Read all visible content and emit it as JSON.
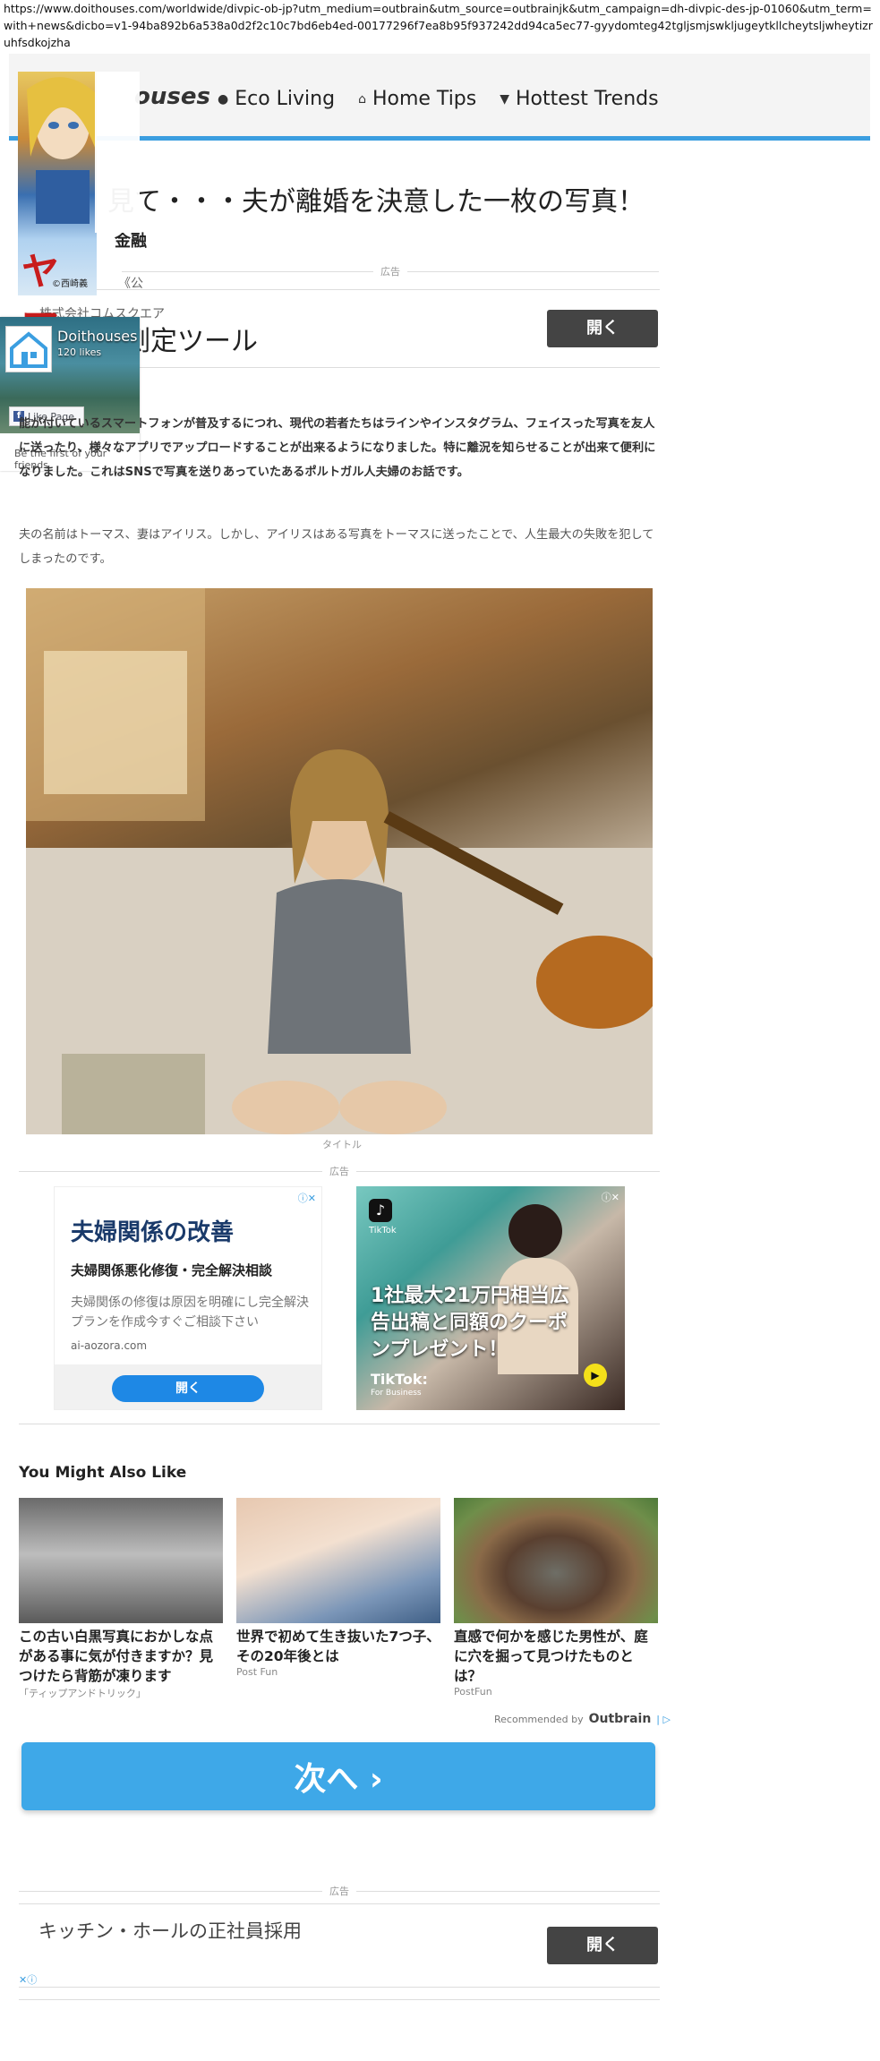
{
  "browser": {
    "url": "https://www.doithouses.com/worldwide/divpic-ob-jp?utm_medium=outbrain&utm_source=outbrainjk&utm_campaign=dh-divpic-des-jp-01060&utm_term=with+news&dicbo=v1-94ba892b6a538a0d2f2c10c7bd6eb4ed-00177296f7ea8b95f937242dd94ca5ec77-gyydomteg42tgljsmjswkljugeytkllcheytsljwheytizruhfsdkojzha"
  },
  "header": {
    "logo_text": "ouses",
    "nav": [
      {
        "label": "Eco Living",
        "icon": "globe-icon"
      },
      {
        "label": "Home Tips",
        "icon": "home-icon"
      },
      {
        "label": "Hottest Trends",
        "icon": "trophy-icon"
      }
    ],
    "accent_color": "#3b9ee0"
  },
  "article": {
    "title": "見て・・・夫が離婚を決意した一枚の写真！",
    "paragraph_1": "能が付いているスマートフォンが普及するにつれ、現代の若者たちはラインやインスタグラム、フェイスった写真を友人に送ったり、様々なアプリでアップロードすることが出来るようになりました。特に離況を知らせることが出来て便利になりました。これはSNSで写真を送りあっていたあるポルトガル人夫婦のお話です。",
    "paragraph_2": "夫の名前はトーマス、妻はアイリス。しかし、アイリスはある写真をトーマスに送ったことで、人生最大の失敗を犯してしまったのです。",
    "photo_caption": "タイトル"
  },
  "top_ad": {
    "label": "広告",
    "kin_text": "金融",
    "bracket_text": "《公",
    "company": "株式会社コムスクエア",
    "headline": "測定ツール",
    "button": "開く"
  },
  "sidebar": {
    "ad_red_text": "ヤマト",
    "ad_small_text": "©西崎義"
  },
  "facebook_box": {
    "name": "Doithouses",
    "likes": "120 likes",
    "like_button": "Like Page",
    "footer": "Be the first of your friends"
  },
  "mid_ads": {
    "label": "広告",
    "card1": {
      "headline": "夫婦関係の改善",
      "subhead": "夫婦関係悪化修復・完全解決相談",
      "body": "夫婦関係の修復は原因を明確にし完全解決プランを作成今すぐご相談下さい",
      "domain": "ai-aozora.com",
      "button": "開く"
    },
    "card2": {
      "brand": "TikTok",
      "headline": "1社最大21万円相当広告出稿と同額のクーポンプレゼント！",
      "footer_brand": "TikTok:",
      "footer_sub": "For Business"
    }
  },
  "you_might_also_like": {
    "heading": "You Might Also Like",
    "items": [
      {
        "title": "この古い白黒写真におかしな点がある事に気が付きますか？見つけたら背筋が凍ります",
        "source": "「ティップアンドトリック」"
      },
      {
        "title": "世界で初めて生き抜いた7つ子、その20年後とは",
        "source": "Post Fun"
      },
      {
        "title": "直感で何かを感じた男性が、庭に穴を掘って見つけたものとは？",
        "source": "PostFun"
      }
    ],
    "recommended_label": "Recommended by",
    "recommended_brand": "Outbrain"
  },
  "next_button": {
    "label": "次へ ›"
  },
  "bottom_ad": {
    "label": "広告",
    "headline": "キッチン・ホールの正社員採用",
    "button": "開く"
  }
}
